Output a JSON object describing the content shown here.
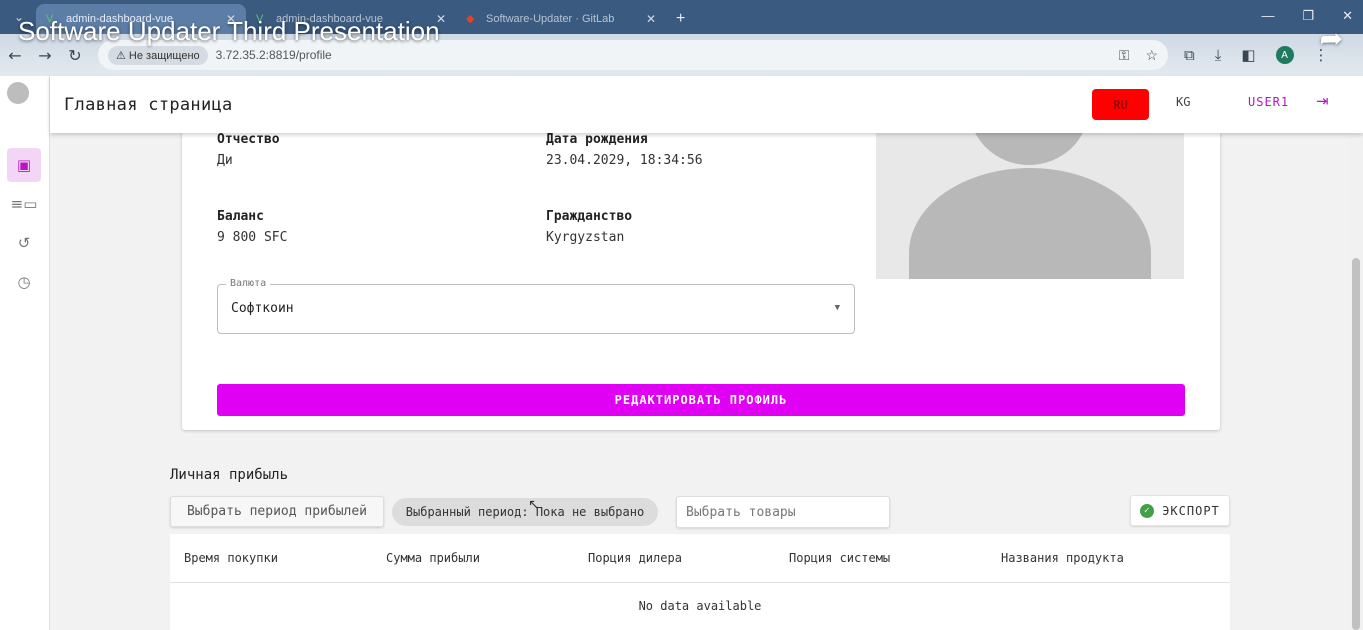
{
  "video_title": "Software Updater Third Presentation",
  "browser": {
    "tabs": [
      {
        "title": "admin-dashboard-vue",
        "icon": "vue-icon",
        "active": true
      },
      {
        "title": "admin-dashboard-vue",
        "icon": "vue-icon",
        "active": false
      },
      {
        "title": "Software-Updater · GitLab",
        "icon": "gitlab-icon",
        "active": false
      }
    ],
    "security_label": "Не защищено",
    "url": "3.72.35.2:8819/profile",
    "profile_initial": "A"
  },
  "app": {
    "title": "Главная страница",
    "lang_ru": "RU",
    "lang_kg": "KG",
    "user": "USER1"
  },
  "profile": {
    "patronymic_label": "Отчество",
    "patronymic": "Ди",
    "birthdate_label": "Дата рождения",
    "birthdate": "23.04.2029, 18:34:56",
    "balance_label": "Баланс",
    "balance": "9 800 SFC",
    "citizenship_label": "Гражданство",
    "citizenship": "Kyrgyzstan",
    "currency_label": "Валюта",
    "currency": "Софткоин",
    "edit_button": "РЕДАКТИРОВАТЬ ПРОФИЛЬ"
  },
  "profit": {
    "title": "Личная прибыль",
    "period_button": "Выбрать период прибылей",
    "period_chip": "Выбранный период: Пока не выбрано",
    "product_placeholder": "Выбрать товары",
    "export_button": "ЭКСПОРТ",
    "columns": [
      "Время покупки",
      "Сумма прибыли",
      "Порция дилера",
      "Порция системы",
      "Названия продукта"
    ],
    "no_data": "No data available"
  },
  "colors": {
    "accent": "#e000f4",
    "lang_active": "#ff0000",
    "export_ok": "#43a047"
  }
}
